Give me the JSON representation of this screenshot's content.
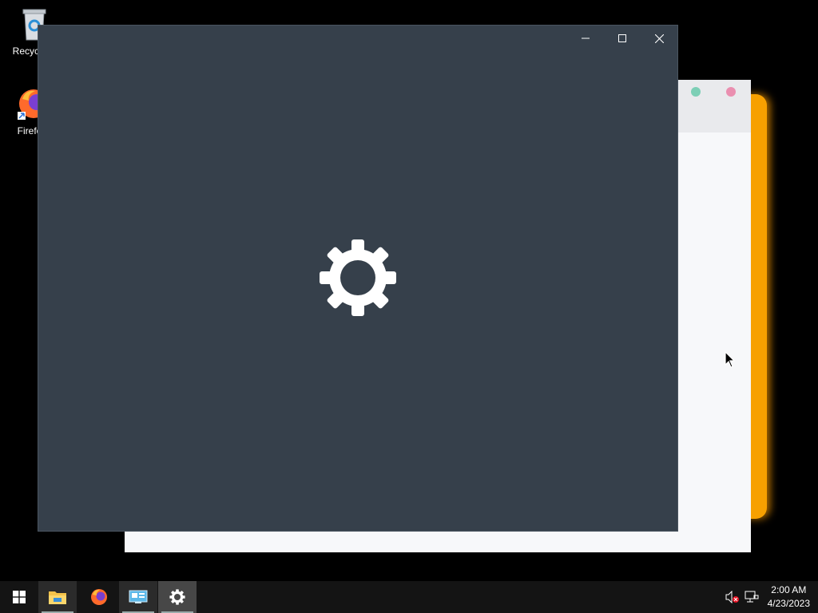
{
  "desktop": {
    "icons": [
      {
        "label": "Recycle",
        "icon": "recycle-bin-icon"
      },
      {
        "label": "Firefo",
        "icon": "firefox-icon"
      }
    ]
  },
  "settings_window": {
    "caption": {
      "minimize": "minimize-icon",
      "maximize": "maximize-icon",
      "close": "close-icon"
    },
    "splash_icon": "gear-icon",
    "background": "#36404b"
  },
  "background_window": {
    "colors": {
      "teal_dot": "#7dcfb6",
      "pink_dot": "#ea8fb0",
      "accent_glow": "#f7a000"
    }
  },
  "taskbar": {
    "apps": [
      {
        "name": "start",
        "icon": "windows-start-icon"
      },
      {
        "name": "file-explorer",
        "icon": "folder-icon"
      },
      {
        "name": "firefox",
        "icon": "firefox-icon"
      },
      {
        "name": "remote-desktop",
        "icon": "remote-desktop-icon"
      },
      {
        "name": "settings",
        "icon": "gear-icon"
      }
    ],
    "tray": {
      "volume_icon": "volume-muted-icon",
      "network_icon": "network-icon",
      "time": "2:00 AM",
      "date": "4/23/2023"
    }
  }
}
